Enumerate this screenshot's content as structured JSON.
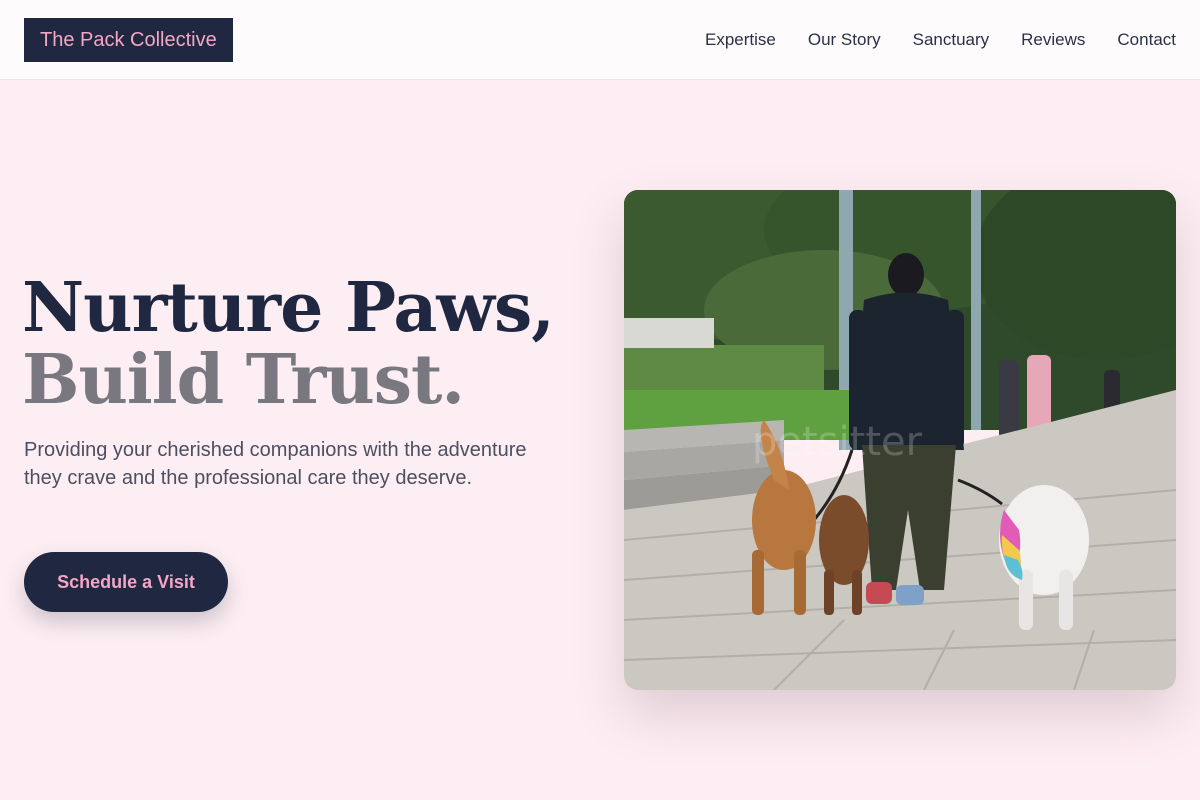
{
  "brand": {
    "name": "The Pack Collective"
  },
  "nav": {
    "items": [
      {
        "label": "Expertise"
      },
      {
        "label": "Our Story"
      },
      {
        "label": "Sanctuary"
      },
      {
        "label": "Reviews"
      },
      {
        "label": "Contact"
      }
    ]
  },
  "hero": {
    "title_line1": "Nurture Paws,",
    "title_line2": "Build Trust.",
    "subtitle": "Providing your cherished companions with the adventure they crave and the professional care they deserve.",
    "cta_label": "Schedule a Visit",
    "photo_watermark": "petsitter"
  },
  "colors": {
    "accent": "#f4a6c6",
    "navy": "#1f2840",
    "background": "#fdeef3"
  }
}
